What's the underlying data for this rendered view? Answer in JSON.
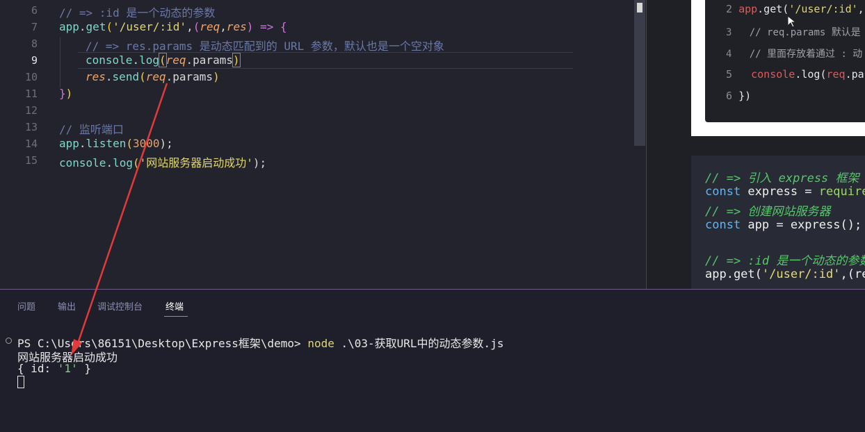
{
  "editor": {
    "lines": [
      {
        "n": "6",
        "text": "// => :id 是一个动态的参数"
      },
      {
        "n": "7",
        "parts": [
          "app",
          ".",
          "get",
          "(",
          "'/user/:id'",
          ",",
          "(",
          "req",
          ",",
          "res",
          ")",
          " => ",
          "{"
        ]
      },
      {
        "n": "8",
        "text": "// => res.params 是动态匹配到的 URL 参数，默认也是一个空对象"
      },
      {
        "n": "9",
        "parts": [
          "console",
          ".",
          "log",
          "(",
          "req",
          ".params",
          ")"
        ]
      },
      {
        "n": "10",
        "parts": [
          "res",
          ".",
          "send",
          "(",
          "req",
          ".params",
          ")"
        ]
      },
      {
        "n": "11",
        "parts": [
          "}",
          ")"
        ]
      },
      {
        "n": "12",
        "text": ""
      },
      {
        "n": "13",
        "text": "// 监听端口"
      },
      {
        "n": "14",
        "parts": [
          "app",
          ".",
          "listen",
          "(",
          "3000",
          ");"
        ]
      },
      {
        "n": "15",
        "parts": [
          "console",
          ".",
          "log",
          "(",
          "'网站服务器启动成功'",
          ");"
        ]
      }
    ]
  },
  "reference_image": {
    "lines": [
      {
        "n": "2",
        "parts": [
          "app",
          ".get(",
          "'/user/:id'",
          ","
        ]
      },
      {
        "n": "3",
        "text": "// req.params 默认是"
      },
      {
        "n": "4",
        "text": "// 里面存放着通过 : 动"
      },
      {
        "n": "5",
        "parts": [
          "console",
          ".log(",
          "req",
          ".par"
        ]
      },
      {
        "n": "6",
        "text": "})"
      }
    ]
  },
  "doc_snippet": {
    "lines": [
      {
        "text": "// => 引入 express 框架",
        "kind": "comment"
      },
      {
        "parts": [
          "const",
          " express = ",
          "require",
          "("
        ],
        "kind": "code"
      },
      {
        "text": "// => 创建网站服务器",
        "kind": "comment"
      },
      {
        "parts": [
          "const",
          " app = express();"
        ],
        "kind": "code"
      },
      {
        "text": "",
        "kind": "blank"
      },
      {
        "text": "// => :id 是一个动态的参数",
        "kind": "comment"
      },
      {
        "parts": [
          "app.get(",
          "'/user/:id'",
          ",(req"
        ],
        "kind": "code"
      }
    ]
  },
  "panel": {
    "tabs": [
      "问题",
      "输出",
      "调试控制台",
      "终端"
    ],
    "active_tab": "终端"
  },
  "terminal": {
    "prompt": "PS C:\\Users\\86151\\Desktop\\Express框架\\demo> ",
    "command": "node",
    "command_args": " .\\03-获取URL中的动态参数.js",
    "output_line1": "网站服务器启动成功",
    "output_obj_open": "{ id: ",
    "output_obj_value": "'1'",
    "output_obj_close": " }"
  },
  "colors": {
    "annotation_arrow": "#e23a3a",
    "active_tab_underline": "#e55bd3"
  }
}
